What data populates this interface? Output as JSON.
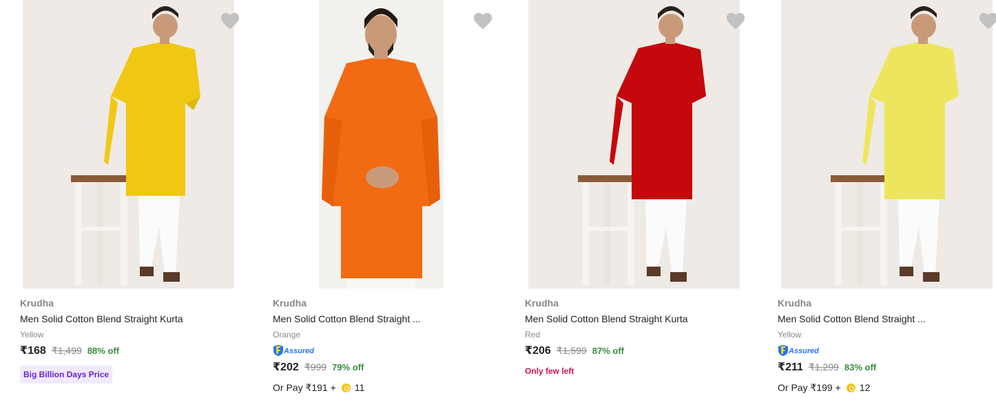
{
  "products": [
    {
      "brand": "Krudha",
      "title": "Men Solid Cotton Blend Straight Kurta",
      "variant": "Yellow",
      "assured": false,
      "price": "₹168",
      "mrp": "₹1,499",
      "discount": "88% off",
      "badge": "Big Billion Days Price",
      "kurta_color": "#f0c814",
      "wishlist_icon": "heart-icon"
    },
    {
      "brand": "Krudha",
      "title": "Men Solid Cotton Blend Straight ...",
      "variant": "Orange",
      "assured": true,
      "assured_label": "Assured",
      "price": "₹202",
      "mrp": "₹999",
      "discount": "79% off",
      "or_pay_text": "Or Pay ₹191 +",
      "coins": "11",
      "kurta_color": "#f26a12",
      "wishlist_icon": "heart-icon"
    },
    {
      "brand": "Krudha",
      "title": "Men Solid Cotton Blend Straight Kurta",
      "variant": "Red",
      "assured": false,
      "price": "₹206",
      "mrp": "₹1,599",
      "discount": "87% off",
      "stock_note": "Only few left",
      "kurta_color": "#c4080c",
      "wishlist_icon": "heart-icon"
    },
    {
      "brand": "Krudha",
      "title": "Men Solid Cotton Blend Straight ...",
      "variant": "Yellow",
      "assured": true,
      "assured_label": "Assured",
      "price": "₹211",
      "mrp": "₹1,299",
      "discount": "83% off",
      "or_pay_text": "Or Pay ₹199 +",
      "coins": "12",
      "kurta_color": "#eee55e",
      "wishlist_icon": "heart-icon"
    }
  ],
  "colors": {
    "discount_green": "#388e3c",
    "badge_purple": "#6b21d0",
    "stock_red": "#d1124b",
    "muted_gray": "#878787"
  }
}
